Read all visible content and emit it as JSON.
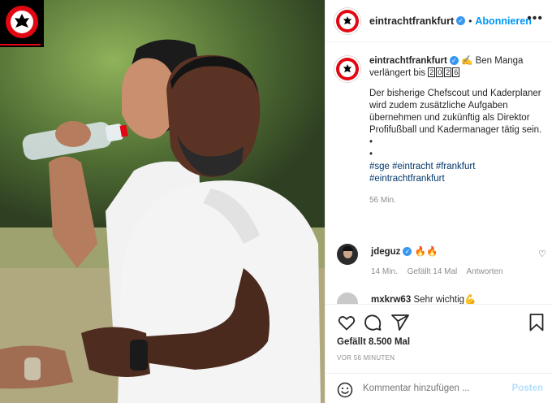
{
  "colors": {
    "accent": "#0095f6",
    "verified": "#3897f0",
    "brand_red": "#e30613",
    "muted": "#8e8e8e",
    "hashtag": "#00376b",
    "post_disabled": "#b2dffc"
  },
  "header": {
    "username": "eintrachtfrankfurt",
    "separator": "•",
    "follow_label": "Abonnieren",
    "more_icon": "more-horizontal-icon"
  },
  "caption": {
    "username": "eintrachtfrankfurt",
    "headline": "✍️ Ben Manga verlängert bis",
    "year_digits": [
      "2",
      "0",
      "2",
      "6"
    ],
    "body": "Der bisherige Chefscout und Kaderplaner wird zudem zusätzliche Aufgaben übernehmen und zukünftig als Direktor Profifußball und Kadermanager tätig sein.",
    "bullet1": "•",
    "bullet2": "•",
    "hashtags_line1": "#sge #eintracht #frankfurt",
    "hashtags_line2": "#eintrachtfrankfurt",
    "time": "56 Min."
  },
  "comments": [
    {
      "username": "jdeguz",
      "text": "🔥🔥",
      "time": "14 Min.",
      "likes": "Gefällt 14 Mal",
      "reply": "Antworten"
    },
    {
      "username": "mxkrw63",
      "text": "Sehr wichtig💪"
    }
  ],
  "actions": {
    "icons": [
      "heart-icon",
      "comment-icon",
      "share-icon",
      "bookmark-icon"
    ],
    "likes": "Gefällt 8.500 Mal",
    "ago": "VOR 56 MINUTEN",
    "comment_placeholder": "Kommentar hinzufügen ...",
    "post_label": "Posten"
  }
}
